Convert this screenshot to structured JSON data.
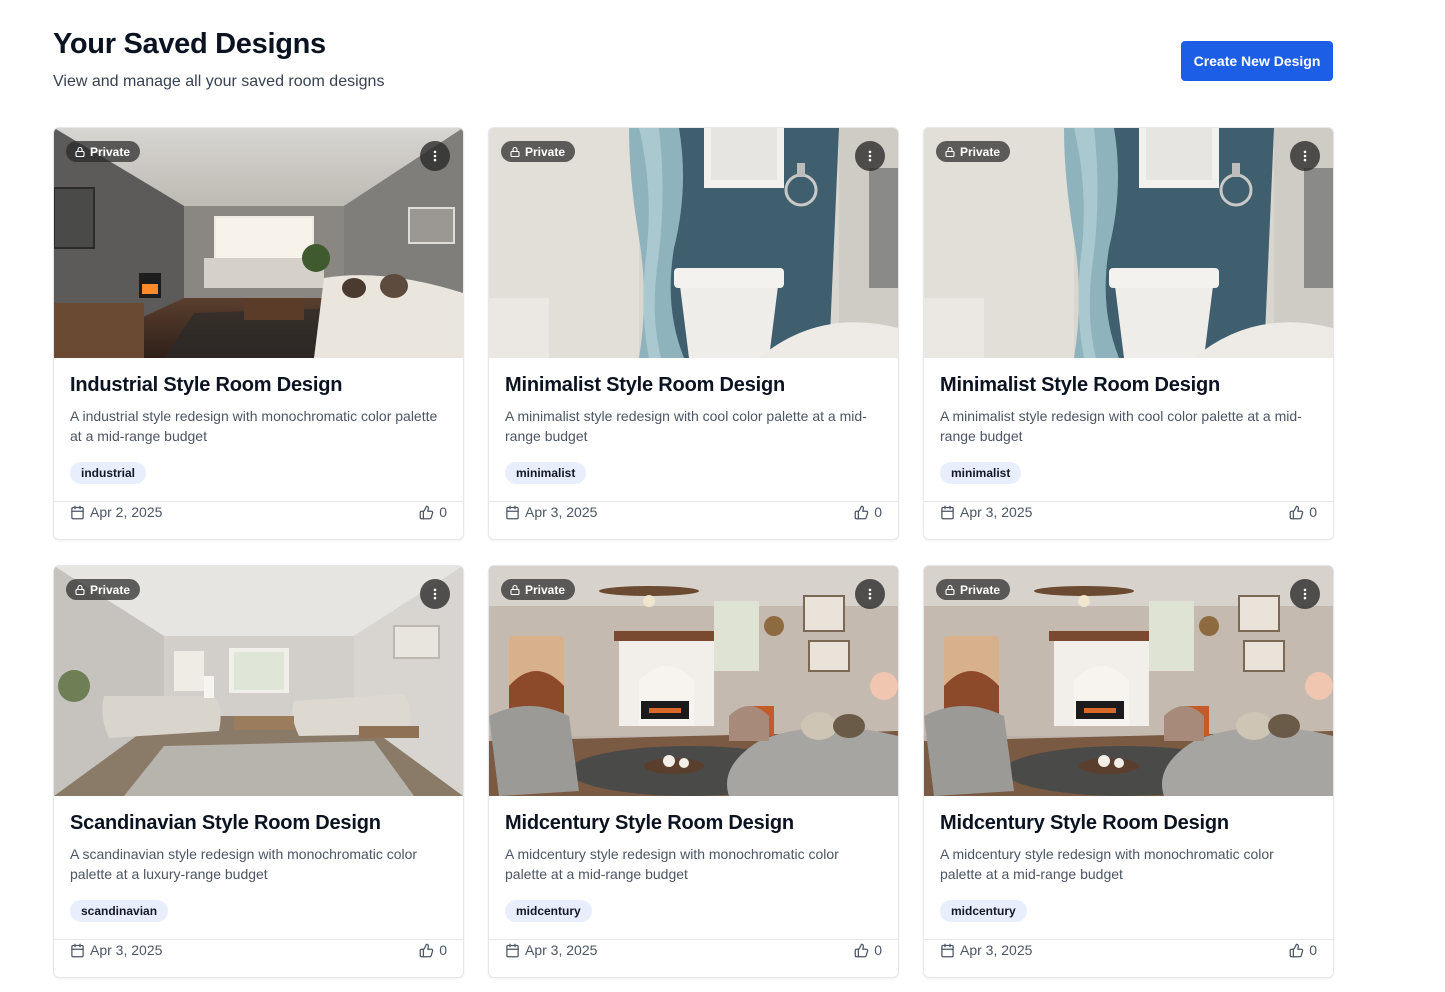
{
  "header": {
    "title": "Your Saved Designs",
    "subtitle": "View and manage all your saved room designs",
    "create_label": "Create New Design"
  },
  "colors": {
    "primary": "#1d5ee6",
    "tag_bg": "#e8eefb"
  },
  "cards": [
    {
      "visibility": "Private",
      "title": "Industrial Style Room Design",
      "description": "A industrial style redesign with monochromatic color palette at a mid-range budget",
      "tag": "industrial",
      "date": "Apr 2, 2025",
      "likes": "0",
      "image": "industrial-living-room"
    },
    {
      "visibility": "Private",
      "title": "Minimalist Style Room Design",
      "description": "A minimalist style redesign with cool color palette at a mid-range budget",
      "tag": "minimalist",
      "date": "Apr 3, 2025",
      "likes": "0",
      "image": "minimalist-bathroom"
    },
    {
      "visibility": "Private",
      "title": "Minimalist Style Room Design",
      "description": "A minimalist style redesign with cool color palette at a mid-range budget",
      "tag": "minimalist",
      "date": "Apr 3, 2025",
      "likes": "0",
      "image": "minimalist-bathroom"
    },
    {
      "visibility": "Private",
      "title": "Scandinavian Style Room Design",
      "description": "A scandinavian style redesign with monochromatic color palette at a luxury-range budget",
      "tag": "scandinavian",
      "date": "Apr 3, 2025",
      "likes": "0",
      "image": "scandinavian-living-room"
    },
    {
      "visibility": "Private",
      "title": "Midcentury Style Room Design",
      "description": "A midcentury style redesign with monochromatic color palette at a mid-range budget",
      "tag": "midcentury",
      "date": "Apr 3, 2025",
      "likes": "0",
      "image": "midcentury-living-room"
    },
    {
      "visibility": "Private",
      "title": "Midcentury Style Room Design",
      "description": "A midcentury style redesign with monochromatic color palette at a mid-range budget",
      "tag": "midcentury",
      "date": "Apr 3, 2025",
      "likes": "0",
      "image": "midcentury-living-room"
    }
  ]
}
